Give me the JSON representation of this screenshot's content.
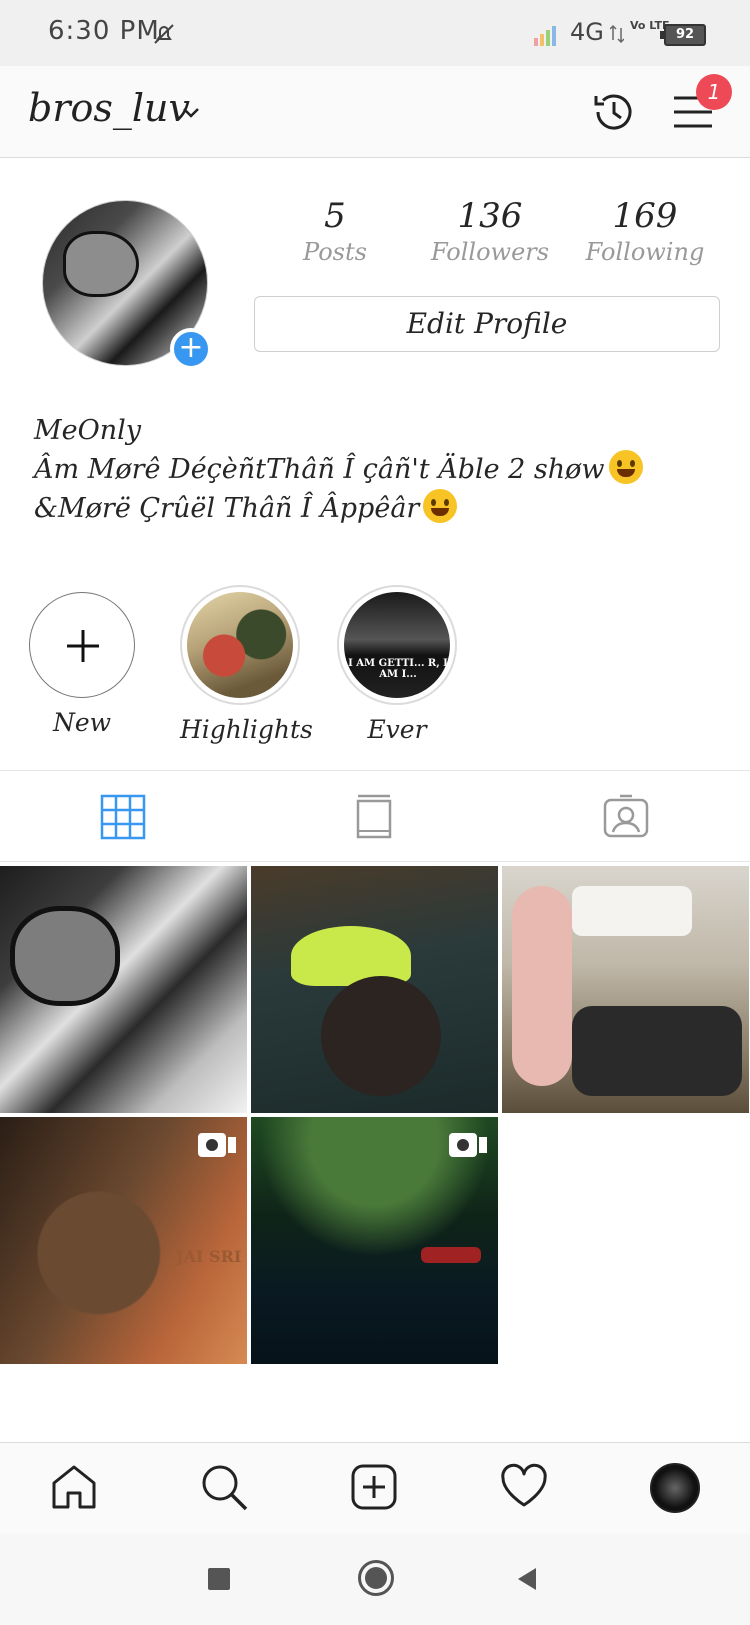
{
  "status_bar": {
    "time": "6:30 PM",
    "network": "4G",
    "volte": "Vo LTE",
    "battery": "92"
  },
  "header": {
    "username": "bros_luv",
    "notification_count": "1"
  },
  "profile": {
    "stats": [
      {
        "value": "5",
        "label": "Posts"
      },
      {
        "value": "136",
        "label": "Followers"
      },
      {
        "value": "169",
        "label": "Following"
      }
    ],
    "edit_button": "Edit Profile",
    "bio_lines": [
      "MeOnly",
      "Âm Mørê DéçèñtThâñ Î çâñ't Äble 2 shøw",
      "&Mørë Çrûël Thâñ Î Âppêâr"
    ]
  },
  "highlights": [
    {
      "label": "New",
      "icon": "plus-icon"
    },
    {
      "label": "Highlights"
    },
    {
      "label": "Ever",
      "text_on_image": "I AM GETTI... R, I AM I..."
    }
  ],
  "tabs": [
    {
      "name": "grid",
      "icon": "grid-icon",
      "active": true
    },
    {
      "name": "igtv",
      "icon": "igtv-icon",
      "active": false
    },
    {
      "name": "tagged",
      "icon": "tagged-icon",
      "active": false
    }
  ],
  "posts": [
    {
      "type": "photo"
    },
    {
      "type": "photo"
    },
    {
      "type": "photo"
    },
    {
      "type": "video",
      "overlay_text": "JAI SRI"
    },
    {
      "type": "video"
    }
  ],
  "bottom_nav": [
    "home-icon",
    "search-icon",
    "add-post-icon",
    "heart-icon",
    "profile-avatar"
  ],
  "colors": {
    "accent": "#3897f0",
    "badge": "#ed4956",
    "muted_text": "#999999"
  }
}
